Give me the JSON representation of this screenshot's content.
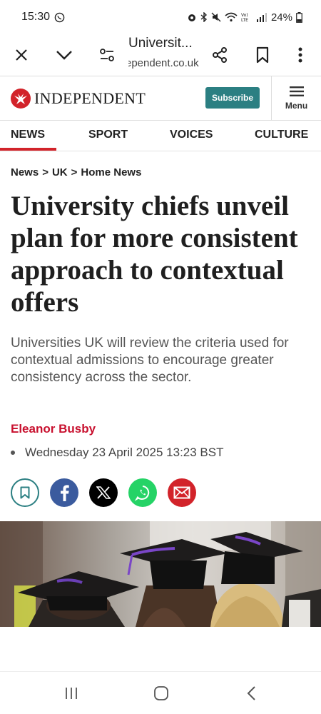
{
  "status_bar": {
    "time": "15:30",
    "battery": "24%",
    "icons": [
      "whatsapp-icon",
      "alarm-icon",
      "bluetooth-icon",
      "mute-icon",
      "wifi-icon",
      "volte-icon",
      "signal-icon",
      "battery-icon"
    ]
  },
  "browser": {
    "tab_title": "Universit...",
    "url": "ependent.co.uk",
    "icons": [
      "close-icon",
      "chevron-down-icon",
      "page-settings-icon",
      "share-icon",
      "bookmark-icon",
      "more-icon"
    ]
  },
  "site": {
    "logo_text": "INDEPENDENT",
    "subscribe_label": "Subscribe",
    "menu_label": "Menu",
    "brand_color": "#d2232a",
    "subscribe_color": "#2b7f82"
  },
  "nav": {
    "items": [
      {
        "label": "NEWS",
        "active": true
      },
      {
        "label": "SPORT"
      },
      {
        "label": "VOICES"
      },
      {
        "label": "CULTURE"
      }
    ]
  },
  "article": {
    "breadcrumb": [
      "News",
      ">",
      "UK",
      ">",
      "Home News"
    ],
    "headline": "University chiefs unveil plan for more consistent approach to contextual offers",
    "standfirst": "Universities UK will review the criteria used for contextual admissions to encourage greater consistency across the sector.",
    "author": "Eleanor Busby",
    "date": "Wednesday 23 April 2025 13:23 BST",
    "share_icons": [
      "bookmark-icon",
      "facebook-icon",
      "x-icon",
      "whatsapp-icon",
      "email-icon"
    ]
  },
  "system_nav": {
    "icons": [
      "recent-apps-icon",
      "home-icon",
      "back-icon"
    ]
  }
}
